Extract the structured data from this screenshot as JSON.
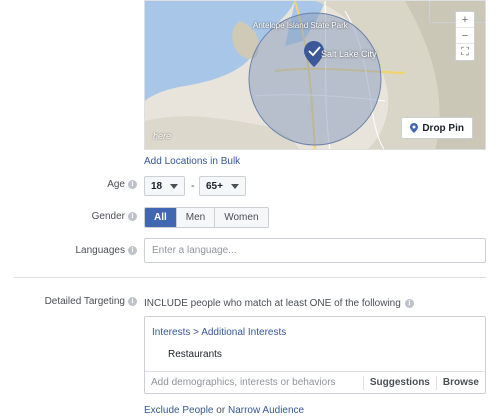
{
  "map": {
    "labels": [
      "Antelope Island State Park",
      "Salt Lake City"
    ],
    "zoom_controls": [
      "+",
      "−",
      "⛶"
    ],
    "drop_pin_label": "Drop Pin",
    "provider_logo": "here",
    "colors": {
      "water": "#a8c7e8",
      "land": "#e8e4dc",
      "radius_fill": "#8ea0c0",
      "pin": "#3b5998"
    }
  },
  "location": {
    "add_bulk_label": "Add Locations in Bulk"
  },
  "age": {
    "label": "Age",
    "min_value": "18",
    "separator": "-",
    "max_value": "65+"
  },
  "gender": {
    "label": "Gender",
    "options": [
      "All",
      "Men",
      "Women"
    ],
    "selected": "All"
  },
  "languages": {
    "label": "Languages",
    "placeholder": "Enter a language..."
  },
  "detailed_targeting": {
    "label": "Detailed Targeting",
    "include_text": "INCLUDE people who match at least ONE of the following",
    "path": "Interests > Additional Interests",
    "items": [
      "Restaurants"
    ],
    "search_placeholder": "Add demographics, interests or behaviors",
    "suggestions_label": "Suggestions",
    "browse_label": "Browse"
  },
  "footer": {
    "exclude_label": "Exclude People",
    "or_text": "or",
    "narrow_label": "Narrow Audience"
  },
  "colors": {
    "accent": "#4267b2",
    "link": "#365899",
    "border": "#ccd0d5"
  }
}
